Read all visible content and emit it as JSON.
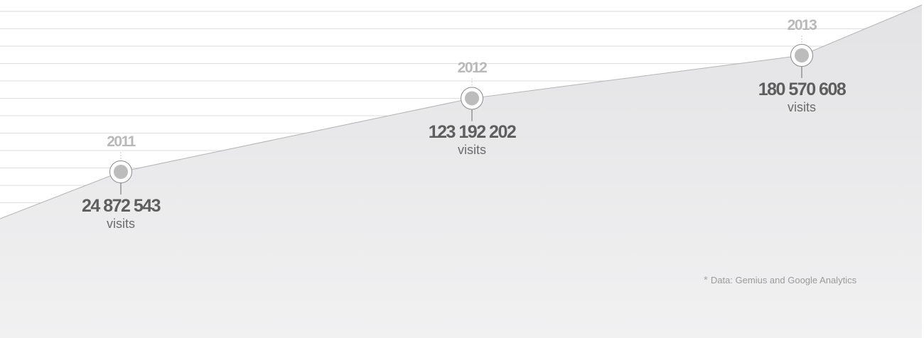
{
  "chart_data": {
    "type": "area",
    "x": [
      "2011",
      "2012",
      "2013"
    ],
    "series": [
      {
        "values": [
          24872543,
          123192202,
          180570608
        ]
      }
    ],
    "value_labels": [
      "24 872 543",
      "123 192 202",
      "180 570 608"
    ],
    "unit": "visits",
    "grid": true,
    "legend": "none"
  },
  "footnote": {
    "star": "*",
    "text": "Data: Gemius and Google Analytics"
  }
}
